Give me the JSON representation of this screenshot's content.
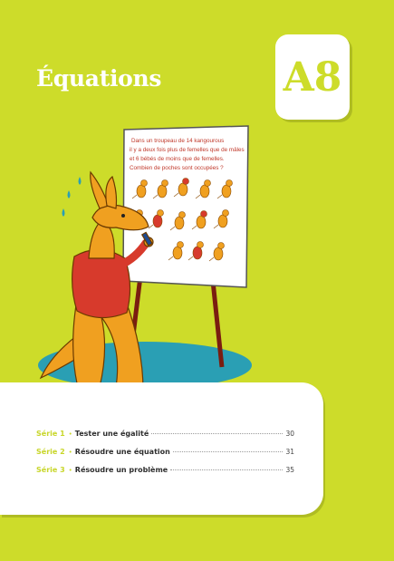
{
  "header": {
    "title": "Équations",
    "badge": "A8"
  },
  "board": {
    "lines": [
      "Dans un troupeau de 14 kangourous",
      "il y a deux fois plus de femelles que de mâles",
      "et 6 bébés de moins que de femelles.",
      "Combien de poches sont occupées ?"
    ]
  },
  "toc": [
    {
      "serie": "Série 1",
      "title": "Tester une égalité",
      "page": "30"
    },
    {
      "serie": "Série 2",
      "title": "Résoudre une équation",
      "page": "31"
    },
    {
      "serie": "Série 3",
      "title": "Résoudre un problème",
      "page": "35"
    }
  ],
  "colors": {
    "background": "#cddc2a",
    "accent": "#c8d62a",
    "board_text": "#c0392b",
    "kangaroo": "#f0a020",
    "shirt": "#d73a2c"
  }
}
